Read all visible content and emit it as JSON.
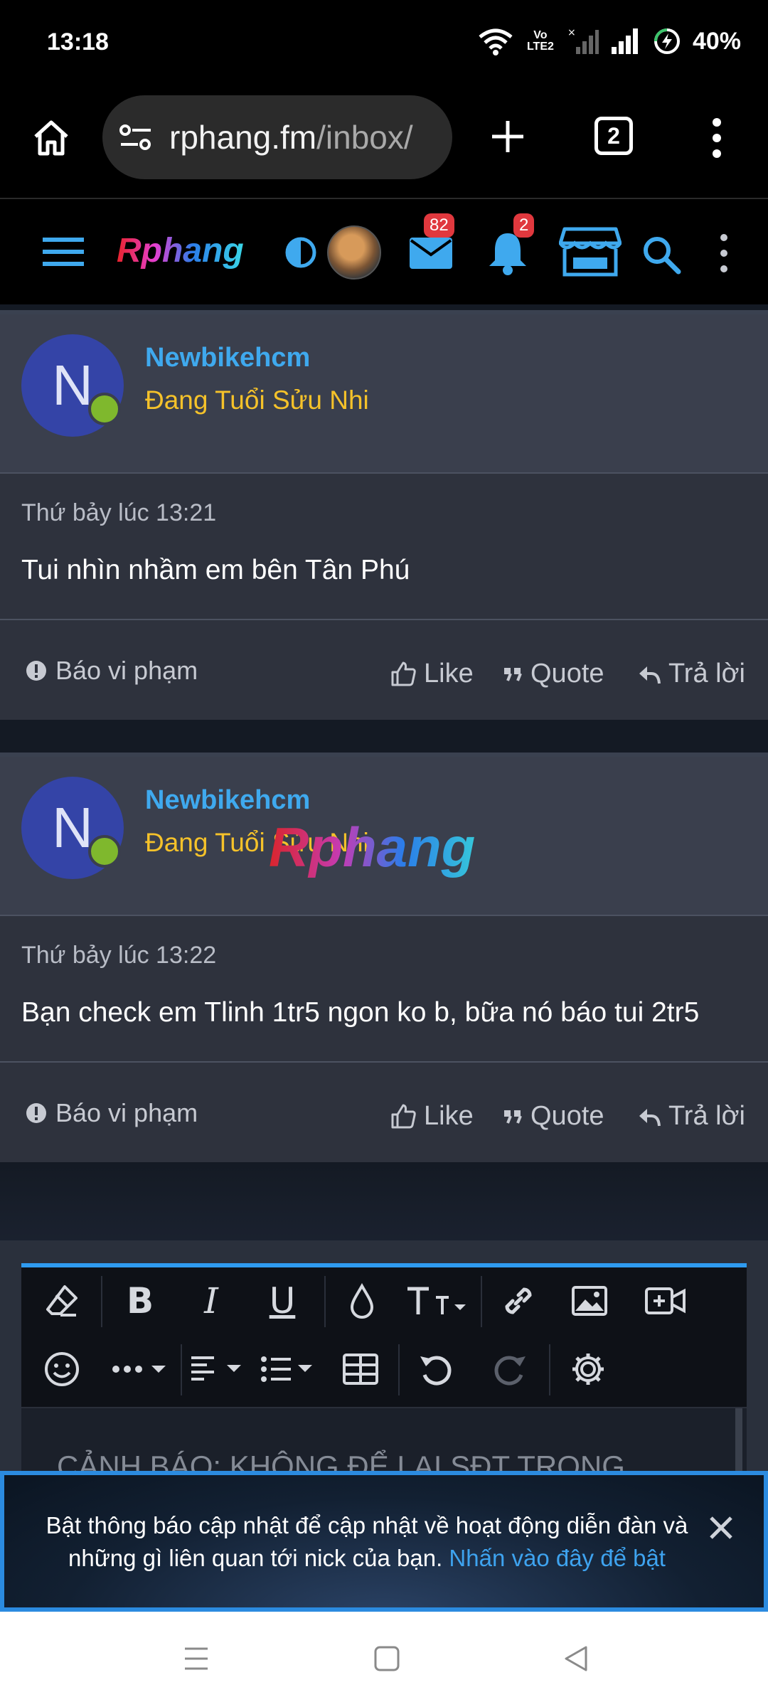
{
  "status_bar": {
    "time": "13:18",
    "battery_percent": "40%",
    "volte_label": "Vo LTE2"
  },
  "browser": {
    "url_host": "rphang.fm",
    "url_path": "/inbox/",
    "tab_count": "2"
  },
  "site_header": {
    "logo_text": "Rphang",
    "inbox_badge": "82",
    "notification_badge": "2"
  },
  "posts": [
    {
      "avatar_letter": "N",
      "username": "Newbikehcm",
      "user_title": "Đang Tuổi Sửu Nhi",
      "time": "Thứ bảy lúc 13:21",
      "text": "Tui nhìn nhầm em bên Tân Phú",
      "report_label": "Báo vi phạm",
      "like_label": "Like",
      "quote_label": "Quote",
      "reply_label": "Trả lời"
    },
    {
      "avatar_letter": "N",
      "username": "Newbikehcm",
      "user_title": "Đang Tuổi Sửu Nhi",
      "time": "Thứ bảy lúc 13:22",
      "text": "Bạn check em Tlinh 1tr5 ngon ko b, bữa nó báo tui 2tr5",
      "report_label": "Báo vi phạm",
      "like_label": "Like",
      "quote_label": "Quote",
      "reply_label": "Trả lời"
    }
  ],
  "watermark_text": "Rphang",
  "editor": {
    "placeholder": "CẢNH BÁO: KHÔNG ĐỂ LẠI SĐT TRONG"
  },
  "notification": {
    "message": "Bật thông báo cập nhật để cập nhật về hoạt động diễn đàn và những gì liên quan tới nick của bạn.",
    "link_text": "Nhấn vào đây để bật"
  },
  "colors": {
    "accent_blue": "#3fa9ee",
    "user_title_gold": "#f5c22a",
    "badge_red": "#e0383e",
    "online_green": "#7fb82d",
    "avatar_blue": "#3444a7"
  }
}
